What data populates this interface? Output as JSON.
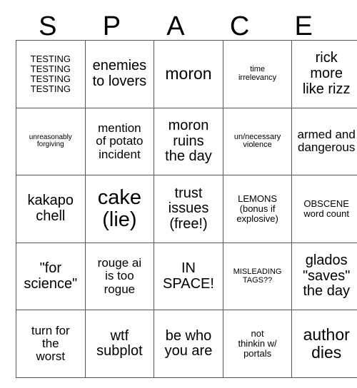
{
  "card": {
    "header_letters": [
      "S",
      "P",
      "A",
      "C",
      "E"
    ],
    "rows": [
      [
        {
          "text": "TESTING\nTESTING\nTESTING\nTESTING",
          "size": "fs-s"
        },
        {
          "text": "enemies\nto lovers",
          "size": "fs-l"
        },
        {
          "text": "moron",
          "size": "fs-xl"
        },
        {
          "text": "time\nirrelevancy",
          "size": "fs-xs"
        },
        {
          "text": "rick\nmore\nlike rizz",
          "size": "fs-l"
        }
      ],
      [
        {
          "text": "unreasonably\nforgiving",
          "size": "fs-xxs"
        },
        {
          "text": "mention\nof potato\nincident",
          "size": "fs-m"
        },
        {
          "text": "moron\nruins\nthe day",
          "size": "fs-l"
        },
        {
          "text": "un/necessary\nviolence",
          "size": "fs-xs"
        },
        {
          "text": "armed and\ndangerous",
          "size": "fs-m"
        }
      ],
      [
        {
          "text": "kakapo\nchell",
          "size": "fs-l"
        },
        {
          "text": "cake\n(lie)",
          "size": "fs-xxl"
        },
        {
          "text": "trust\nissues\n(free!)",
          "size": "fs-l"
        },
        {
          "text": "LEMONS\n(bonus if\nexplosive)",
          "size": "fs-s"
        },
        {
          "text": "OBSCENE\nword count",
          "size": "fs-s"
        }
      ],
      [
        {
          "text": "\"for\nscience\"",
          "size": "fs-l"
        },
        {
          "text": "rouge ai\nis too\nrogue",
          "size": "fs-m"
        },
        {
          "text": "IN\nSPACE!",
          "size": "fs-l"
        },
        {
          "text": "MISLEADING\nTAGS??",
          "size": "fs-xs"
        },
        {
          "text": "glados\n\"saves\"\nthe day",
          "size": "fs-l"
        }
      ],
      [
        {
          "text": "turn for\nthe\nworst",
          "size": "fs-m"
        },
        {
          "text": "wtf\nsubplot",
          "size": "fs-l"
        },
        {
          "text": "be who\nyou are",
          "size": "fs-l"
        },
        {
          "text": "not\nthinkin w/\nportals",
          "size": "fs-s"
        },
        {
          "text": "author\ndies",
          "size": "fs-xl"
        }
      ]
    ]
  },
  "colors": {
    "background": "#ffffff",
    "text": "#000000",
    "grid_line": "#555555"
  }
}
